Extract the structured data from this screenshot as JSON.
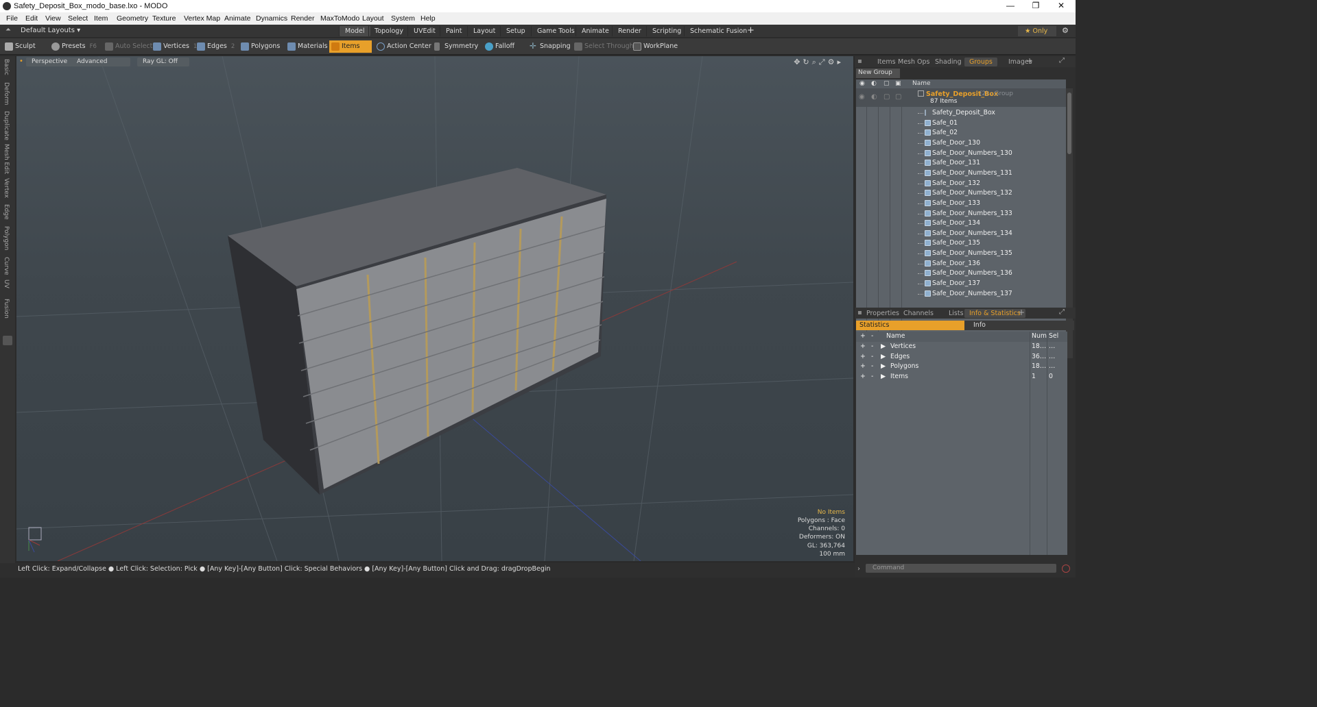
{
  "window": {
    "title": "Safety_Deposit_Box_modo_base.lxo - MODO"
  },
  "menu": [
    "File",
    "Edit",
    "View",
    "Select",
    "Item",
    "Geometry",
    "Texture",
    "Vertex Map",
    "Animate",
    "Dynamics",
    "Render",
    "MaxToModo",
    "Layout",
    "System",
    "Help"
  ],
  "layouts": {
    "label": "Default Layouts ▾"
  },
  "tabs": [
    "Model",
    "Topology",
    "UVEdit",
    "Paint",
    "Layout",
    "Setup",
    "Game Tools",
    "Animate",
    "Render",
    "Scripting",
    "Schematic Fusion"
  ],
  "only_label": "★  Only",
  "toolbar": {
    "sculpt": "Sculpt",
    "presets": "Presets",
    "presets_key": "F6",
    "auto_select": "Auto Select",
    "vertices": "Vertices",
    "vertices_key": "1",
    "edges": "Edges",
    "edges_key": "2",
    "polygons": "Polygons",
    "materials": "Materials",
    "items": "Items",
    "action_center": "Action Center",
    "symmetry": "Symmetry",
    "falloff": "Falloff",
    "snapping": "Snapping",
    "select_through": "Select Through",
    "workplane": "WorkPlane"
  },
  "left_tabs": [
    "Basic",
    "Deform",
    "Duplicate",
    "Mesh Edit",
    "Vertex",
    "Edge",
    "Polygon",
    "Curve",
    "UV",
    "Fusion"
  ],
  "viewport": {
    "view": "Perspective",
    "mode": "Advanced",
    "raygl": "Ray GL: Off",
    "hud": {
      "items": "No Items",
      "polygons": "Polygons : Face",
      "channels": "Channels: 0",
      "deformers": "Deformers: ON",
      "gl": "GL: 363,764",
      "scale": "100 mm"
    }
  },
  "status": "Left Click: Expand/Collapse ● Left Click: Selection: Pick ● [Any Key]-[Any Button] Click: Special Behaviors ● [Any Key]-[Any Button] Click and Drag: dragDropBegin",
  "panel_tabs": [
    "Items",
    "Mesh Ops",
    "Shading",
    "Groups",
    "Images"
  ],
  "groups": {
    "new_group": "New Group",
    "name_header": "Name",
    "group_name": "Safety_Deposit_Box",
    "group_sub": "(2) : Group",
    "count": "87 Items",
    "items": [
      "Safety_Deposit_Box",
      "Safe_01",
      "Safe_02",
      "Safe_Door_130",
      "Safe_Door_Numbers_130",
      "Safe_Door_131",
      "Safe_Door_Numbers_131",
      "Safe_Door_132",
      "Safe_Door_Numbers_132",
      "Safe_Door_133",
      "Safe_Door_Numbers_133",
      "Safe_Door_134",
      "Safe_Door_Numbers_134",
      "Safe_Door_135",
      "Safe_Door_Numbers_135",
      "Safe_Door_136",
      "Safe_Door_Numbers_136",
      "Safe_Door_137",
      "Safe_Door_Numbers_137"
    ]
  },
  "lower_tabs": [
    "Properties",
    "Channels",
    "Lists",
    "Info & Statistics"
  ],
  "stats": {
    "tab_statistics": "Statistics",
    "tab_info": "Info",
    "headers": {
      "name": "Name",
      "num": "Num",
      "sel": "Sel"
    },
    "rows": [
      {
        "name": "Vertices",
        "num": "18…",
        "sel": "…"
      },
      {
        "name": "Edges",
        "num": "36…",
        "sel": "…"
      },
      {
        "name": "Polygons",
        "num": "18…",
        "sel": "…"
      },
      {
        "name": "Items",
        "num": "1",
        "sel": "0"
      }
    ]
  },
  "command": {
    "placeholder": "Command"
  }
}
